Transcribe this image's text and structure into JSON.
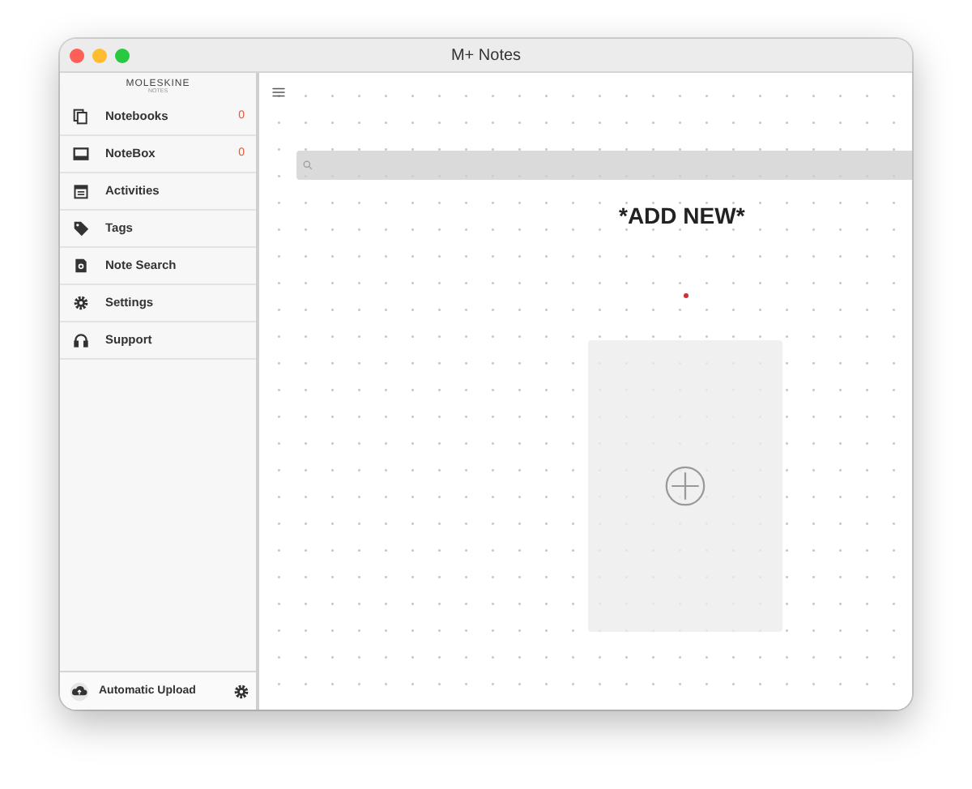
{
  "window": {
    "title": "M+ Notes"
  },
  "logo": {
    "brand": "MOLESKINE",
    "sub": "NOTES"
  },
  "sidebar": {
    "items": [
      {
        "label": "Notebooks",
        "count": "0"
      },
      {
        "label": "NoteBox",
        "count": "0"
      },
      {
        "label": "Activities"
      },
      {
        "label": "Tags"
      },
      {
        "label": "Note Search"
      },
      {
        "label": "Settings"
      },
      {
        "label": "Support"
      }
    ],
    "footer": {
      "label": "Automatic Upload"
    }
  },
  "main": {
    "heading": "*ADD NEW*"
  }
}
